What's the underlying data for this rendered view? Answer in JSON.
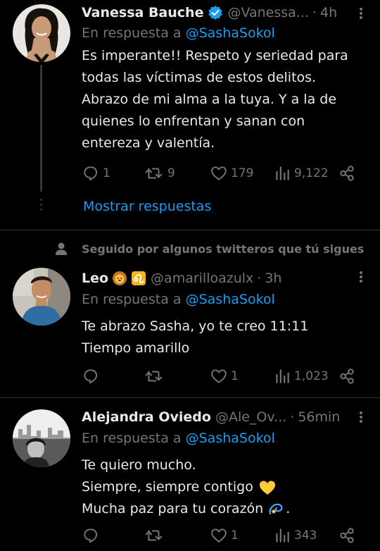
{
  "tweets": [
    {
      "name": "Vanessa Bauche",
      "verified": true,
      "handle": "@Vanessa...",
      "time": "4h",
      "reply_prefix": "En respuesta a",
      "reply_to": "@SashaSokol",
      "body": [
        "Es imperante!! Respeto y seriedad para",
        "todas las víctimas de estos delitos.",
        "Abrazo de mi alma a la tuya. Y a la de",
        "quienes lo enfrentan y sanan con",
        "entereza y valentía."
      ],
      "replies": "1",
      "retweets": "9",
      "likes": "179",
      "views": "9,122",
      "show_replies": "Mostrar respuestas"
    },
    {
      "social_context": "Seguido por algunos twitteros que tú sigues",
      "name": "Leo",
      "emojis": [
        "lion-face-emoji",
        "leo-sign-emoji"
      ],
      "handle": "@amarilloazulx",
      "time": "3h",
      "reply_prefix": "En respuesta a",
      "reply_to": "@SashaSokol",
      "body": [
        "Te abrazo Sasha, yo te creo 11:11",
        "Tiempo amarillo"
      ],
      "replies": "",
      "retweets": "",
      "likes": "1",
      "views": "1,023"
    },
    {
      "name": "Alejandra Oviedo",
      "handle": "@Ale_Ov...",
      "time": "56min",
      "reply_prefix": "En respuesta a",
      "reply_to": "@SashaSokol",
      "body": [
        "Te quiero mucho.",
        "Siempre, siempre contigo",
        "Mucha paz para tu corazón"
      ],
      "body_end": ".",
      "replies": "",
      "retweets": "",
      "likes": "1",
      "views": "343"
    }
  ],
  "colors": {
    "background": "#000000",
    "text": "#e7e9ea",
    "muted": "#71767b",
    "link": "#1d9bf0",
    "divider": "#2f3336",
    "verified": "#1d9bf0"
  },
  "icons": [
    "reply-icon",
    "retweet-icon",
    "like-icon",
    "views-icon",
    "share-icon",
    "more-icon",
    "verified-badge-icon",
    "person-icon",
    "yellow-heart-emoji",
    "dizzy-emoji"
  ]
}
